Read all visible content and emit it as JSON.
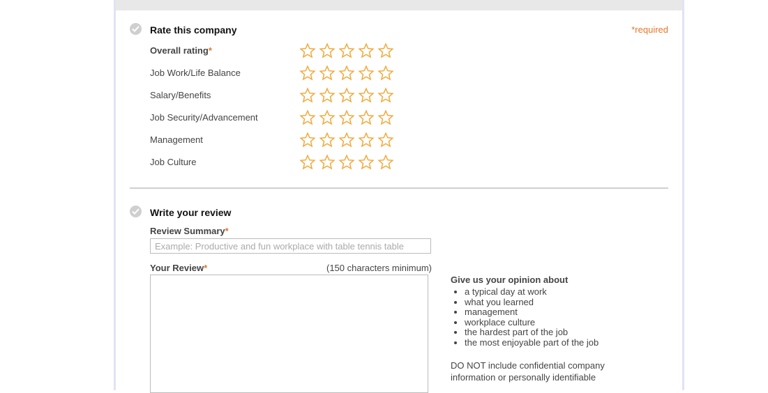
{
  "rate_section": {
    "title": "Rate this company",
    "required_note": "*required",
    "rows": [
      {
        "label": "Overall rating",
        "required": "*",
        "stars": 5,
        "filled": 0
      },
      {
        "label": "Job Work/Life Balance",
        "stars": 5,
        "filled": 0
      },
      {
        "label": "Salary/Benefits",
        "stars": 5,
        "filled": 0
      },
      {
        "label": "Job Security/Advancement",
        "stars": 5,
        "filled": 0
      },
      {
        "label": "Management",
        "stars": 5,
        "filled": 0
      },
      {
        "label": "Job Culture",
        "stars": 5,
        "filled": 0
      }
    ]
  },
  "review_section": {
    "title": "Write your review",
    "summary_label": "Review Summary",
    "summary_required": "*",
    "summary_placeholder": "Example: Productive and fun workplace with table tennis table",
    "summary_value": "",
    "review_label": "Your Review",
    "review_required": "*",
    "min_chars": "(150 characters minimum)",
    "review_value": ""
  },
  "guide": {
    "title": "Give us your opinion about",
    "items": [
      "a typical day at work",
      "what you learned",
      "management",
      "workplace culture",
      "the hardest part of the job",
      "the most enjoyable part of the job"
    ],
    "note": "DO NOT include confidential company information or personally identifiable"
  },
  "colors": {
    "star_outline": "#f2a93b",
    "required": "#e8762a",
    "check_circle": "#cfcfcf",
    "frame": "#dfe3f4"
  },
  "icons": {
    "check": "check-circle-icon",
    "star": "star-outline-icon"
  }
}
